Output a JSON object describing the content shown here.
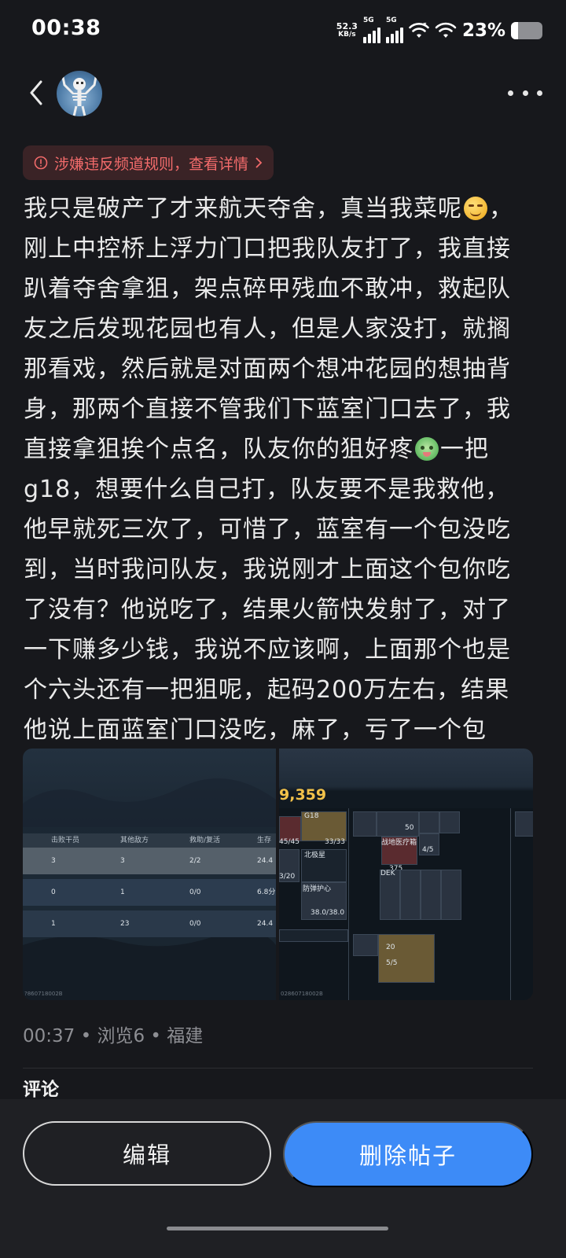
{
  "status_bar": {
    "time": "00:38",
    "net_speed_value": "52.3",
    "net_speed_unit": "KB/s",
    "sim1": "5G",
    "sim2": "5G",
    "battery_pct": "23%",
    "battery_level": 0.23
  },
  "nav": {
    "back_icon": "chevron-left-icon",
    "avatar_icon": "skeleton-avatar",
    "more_icon": "more-dots-icon"
  },
  "warning": {
    "text": "涉嫌违反频道规则，查看详情",
    "color": "#f26b6b"
  },
  "post": {
    "lines": [
      [
        "我只是破产了才来航天夺舍，真当我菜呢",
        "{smirk}",
        "，"
      ],
      [
        "刚上中控桥上浮力门口把我队友打了，我直接"
      ],
      [
        "趴着夺舍拿狙，架点碎甲残血不敢冲，救起队"
      ],
      [
        "友之后发现花园也有人，但是人家没打，就搁"
      ],
      [
        "那看戏，然后就是对面两个想冲花园的想抽背"
      ],
      [
        "身，那两个直接不管我们下蓝室门口去了，我"
      ],
      [
        "直接拿狙挨个点名，队友你的狙好疼",
        "{dog}",
        "一把"
      ],
      [
        "g18，想要什么自己打，队友要不是我救他，"
      ],
      [
        "他早就死三次了，可惜了，蓝室有一个包没吃"
      ],
      [
        "到，当时我问队友，我说刚才上面这个包你吃"
      ],
      [
        "了没有？他说吃了，结果火箭快发射了，对了"
      ],
      [
        "一下赚多少钱，我说不应该啊，上面那个也是"
      ],
      [
        "个六头还有一把狙呢，起码200万左右，结果"
      ],
      [
        "他说上面蓝室门口没吃，麻了，亏了一个包"
      ]
    ]
  },
  "images": {
    "left": {
      "headers": [
        "击败干员",
        "其他敌方",
        "救助/复活",
        "生存时"
      ],
      "rows": [
        [
          "3",
          "3",
          "2/2",
          "24.4"
        ],
        [
          "0",
          "1",
          "0/0",
          "6.8分"
        ],
        [
          "1",
          "23",
          "0/0",
          "24.4"
        ]
      ],
      "watermark": "?860718002B"
    },
    "right": {
      "money": "9,359",
      "labels": [
        "G18",
        "45/45",
        "33/33",
        "3/20",
        "38.0/38.0",
        "4/5",
        "5/5",
        "50",
        "375",
        "20",
        "DEK",
        "北极星",
        "战地医疗箱",
        "防弹护心"
      ],
      "watermark": "02860718002B"
    }
  },
  "meta": {
    "text": "00:37 • 浏览6 • 福建"
  },
  "comments_label": "评论",
  "actions": {
    "edit_label": "编辑",
    "delete_label": "删除帖子",
    "delete_color": "#3d8bf7"
  }
}
